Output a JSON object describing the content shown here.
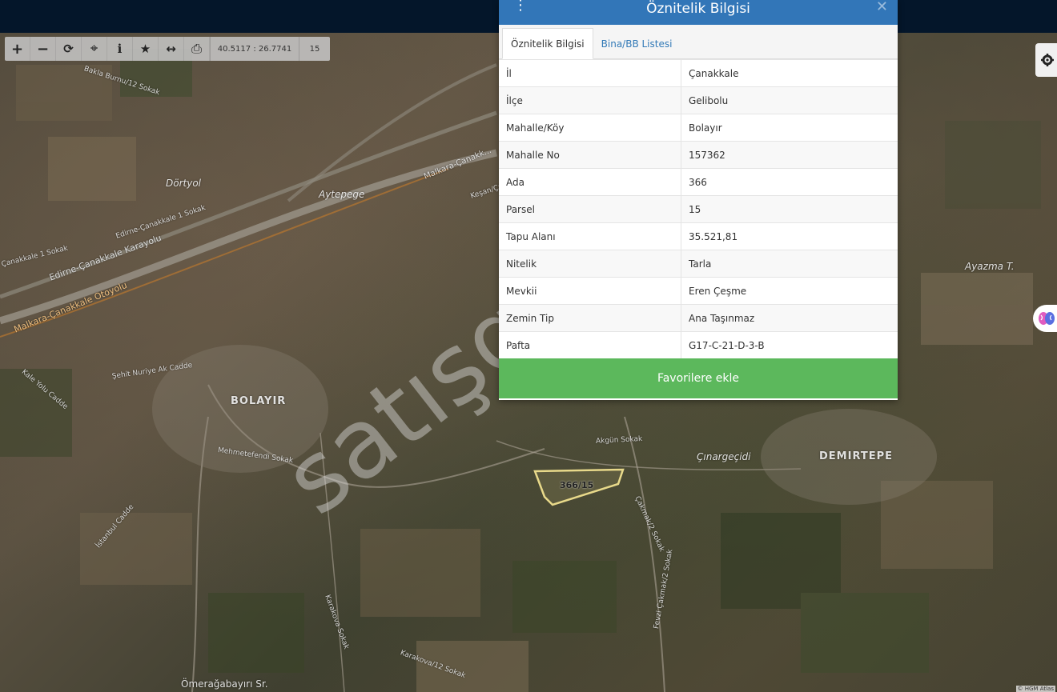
{
  "toolbar": {
    "coordinates": "40.5117 : 26.7741",
    "zoom": "15",
    "tools": [
      {
        "name": "zoom-in",
        "glyph": "+"
      },
      {
        "name": "zoom-out",
        "glyph": "−"
      },
      {
        "name": "refresh",
        "glyph": "⟳"
      },
      {
        "name": "locate",
        "glyph": "⌖"
      },
      {
        "name": "info",
        "glyph": "i"
      },
      {
        "name": "favorite",
        "glyph": "★"
      },
      {
        "name": "measure",
        "glyph": "↔"
      },
      {
        "name": "print",
        "glyph": "⎙"
      }
    ]
  },
  "popup": {
    "title": "Öznitelik Bilgisi",
    "tabs": [
      {
        "label": "Öznitelik Bilgisi",
        "active": true
      },
      {
        "label": "Bina/BB Listesi",
        "active": false
      }
    ],
    "rows": [
      {
        "key": "İl",
        "value": "Çanakkale"
      },
      {
        "key": "İlçe",
        "value": "Gelibolu"
      },
      {
        "key": "Mahalle/Köy",
        "value": "Bolayır"
      },
      {
        "key": "Mahalle No",
        "value": "157362"
      },
      {
        "key": "Ada",
        "value": "366"
      },
      {
        "key": "Parsel",
        "value": "15"
      },
      {
        "key": "Tapu Alanı",
        "value": "35.521,81"
      },
      {
        "key": "Nitelik",
        "value": "Tarla"
      },
      {
        "key": "Mevkii",
        "value": "Eren Çeşme"
      },
      {
        "key": "Zemin Tip",
        "value": "Ana Taşınmaz"
      },
      {
        "key": "Pafta",
        "value": "G17-C-21-D-3-B"
      }
    ],
    "favorite_button": "Favorilere ekle"
  },
  "map": {
    "parcel_label": "366/15",
    "watermark": "satışga",
    "places": {
      "bolayir": "BOLAYIR",
      "demirtepe": "DEMIRTEPE",
      "dortyol": "Dörtyol",
      "aytepege": "Aytepege",
      "ayazma": "Ayazma T.",
      "cinargecidi": "Çınargeçidi",
      "omeragabayiri": "Ömerağabayırı Sr."
    },
    "roads": {
      "bakla": "Bakla Burnu/12 Sokak",
      "edirne_kar": "Edirne-Çanakkale 1 Sokak",
      "canakkale1": "Çanakkale 1 Sokak",
      "karayolu": "Edirne-Çanakkale Karayolu",
      "otoyolu": "Malkara-Çanakkale Otoyolu",
      "malkara": "Malkara-Çanakk...",
      "kesan": "Keşan/Ça...",
      "sehit": "Şehit Nuriye Ak Cadde",
      "kale": "Kale Yolu Cadde",
      "mehmetefendi": "Mehmetefendi Sokak",
      "akgun": "Akgün Sokak",
      "istanbul": "İstanbul Cadde",
      "karakova": "Karakova Sokak",
      "karakova12": "Karakova/12 Sokak",
      "fevzi": "Fevzi Çakmak/2 Sokak",
      "cakmak": "Çakmak/2 Sokak"
    },
    "attribution": "© HGM Atlas"
  },
  "colors": {
    "header_blue": "#3276b8",
    "favorite_green": "#5cb85c",
    "topbar": "#04162a",
    "tab_link": "#337ab7"
  }
}
